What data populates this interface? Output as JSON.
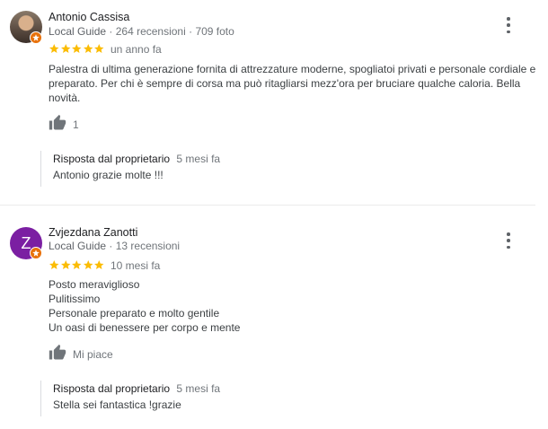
{
  "reviews": [
    {
      "author": "Antonio Cassisa",
      "role": "Local Guide",
      "stats": "· 264 recensioni · 709 foto",
      "rating": 5,
      "date": "un anno fa",
      "text_lines": [
        "Palestra di ultima generazione fornita di attrezzature moderne, spogliatoi privati e personale cordiale e",
        "preparato. Per chi è sempre di corsa ma può ritagliarsi mezz'ora per bruciare qualche caloria. Bella",
        "novità."
      ],
      "likes": "1",
      "owner_reply": {
        "label": "Risposta dal proprietario",
        "date": "5 mesi fa",
        "text": "Antonio grazie molte !!!"
      }
    },
    {
      "author": "Zvjezdana Zanotti",
      "avatar_letter": "Z",
      "role": "Local Guide",
      "stats": "· 13 recensioni",
      "rating": 5,
      "date": "10 mesi fa",
      "text_lines": [
        "Posto meraviglioso",
        "Pulitissimo",
        "Personale preparato e molto gentile",
        "Un oasi di benessere per corpo e mente"
      ],
      "likes_label": "Mi piace",
      "owner_reply": {
        "label": "Risposta dal proprietario",
        "date": "5 mesi fa",
        "text": "Stella sei fantastica !grazie"
      }
    }
  ],
  "colors": {
    "star": "#fbbc04",
    "badge": "#e8710a",
    "avatar_letter_bg": "#7b1fa2",
    "muted": "#70757a"
  },
  "icons": {
    "more": "more-vert-icon",
    "like": "thumb-up-icon",
    "star": "star-icon",
    "badge": "local-guide-badge-icon"
  }
}
